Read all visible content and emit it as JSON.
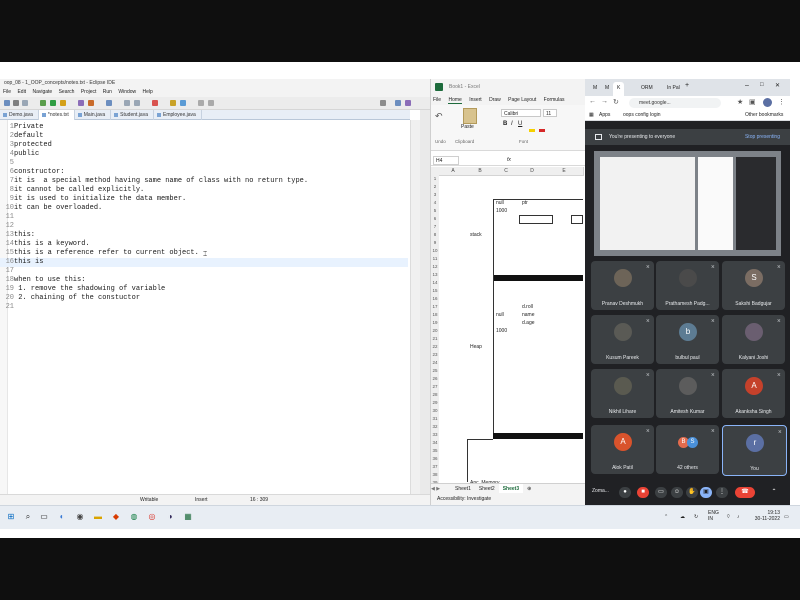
{
  "eclipse": {
    "title": "oop_08 - 1_OOP_concepts/notes.txt - Eclipse IDE",
    "menu": [
      "File",
      "Edit",
      "Navigate",
      "Search",
      "Project",
      "Run",
      "Window",
      "Help"
    ],
    "tabs": [
      {
        "label": "Demo.java",
        "active": false
      },
      {
        "label": "*notes.txt",
        "active": true
      },
      {
        "label": "Main.java",
        "active": false
      },
      {
        "label": "Student.java",
        "active": false
      },
      {
        "label": "Employee.java",
        "active": false
      }
    ],
    "code_lines": [
      {
        "n": "1",
        "text": "Private"
      },
      {
        "n": "2",
        "text": "default"
      },
      {
        "n": "3",
        "text": "protected"
      },
      {
        "n": "4",
        "text": "public"
      },
      {
        "n": "5",
        "text": ""
      },
      {
        "n": "6",
        "text": "constructor:"
      },
      {
        "n": "7",
        "text": "it is  a special method having same name of class with no return type."
      },
      {
        "n": "8",
        "text": "it cannot be called explicitly."
      },
      {
        "n": "9",
        "text": "it is used to initialize the data member."
      },
      {
        "n": "10",
        "text": "it can be overloaded."
      },
      {
        "n": "11",
        "text": ""
      },
      {
        "n": "12",
        "text": ""
      },
      {
        "n": "13",
        "text": "this:"
      },
      {
        "n": "14",
        "text": "this is a keyword."
      },
      {
        "n": "15",
        "text": "this is a reference refer to current object."
      },
      {
        "n": "16",
        "text": "this is "
      },
      {
        "n": "17",
        "text": ""
      },
      {
        "n": "18",
        "text": "when to use this:"
      },
      {
        "n": "19",
        "text": " 1. remove the shadowing of variable"
      },
      {
        "n": "20",
        "text": " 2. chaining of the constuctor"
      },
      {
        "n": "21",
        "text": ""
      }
    ],
    "status": {
      "mode": "Writable",
      "insert": "Insert",
      "position": "16 : 309"
    }
  },
  "excel": {
    "title": "Book1 - Excel",
    "ribbon_tabs": [
      "File",
      "Home",
      "Insert",
      "Draw",
      "Page Layout",
      "Formulas"
    ],
    "ribbon": {
      "paste": "Paste",
      "font": "Calibri",
      "size": "11",
      "undo": "Undo",
      "clipboard": "Clipboard",
      "font_group": "Font"
    },
    "name_box": "H4",
    "fx": "fx",
    "columns": [
      "A",
      "B",
      "C",
      "D",
      "E"
    ],
    "rows": [
      "1",
      "2",
      "3",
      "4",
      "5",
      "6",
      "7",
      "8",
      "9",
      "10",
      "11",
      "12",
      "13",
      "14",
      "15",
      "16",
      "17",
      "18",
      "19",
      "20",
      "21",
      "22",
      "23",
      "24",
      "25",
      "26",
      "27",
      "28",
      "29",
      "30",
      "31",
      "32",
      "33",
      "34",
      "35",
      "36",
      "37",
      "38",
      "39"
    ],
    "cells": [
      {
        "text": "stack",
        "col": "B",
        "row": 8
      },
      {
        "text": "null",
        "col": "C",
        "row": 4
      },
      {
        "text": "1000",
        "col": "C",
        "row": 5
      },
      {
        "text": "ptr",
        "col": "D",
        "row": 4
      },
      {
        "text": "Heap",
        "col": "B",
        "row": 22
      },
      {
        "text": "null",
        "col": "C",
        "row": 18
      },
      {
        "text": "1000",
        "col": "C",
        "row": 20
      },
      {
        "text": "d.roll",
        "col": "D",
        "row": 17
      },
      {
        "text": "name",
        "col": "D",
        "row": 18
      },
      {
        "text": "d.age",
        "col": "D",
        "row": 19
      },
      {
        "text": "Anc. Memory",
        "col": "B",
        "row": 39
      }
    ],
    "sheets": [
      {
        "label": "Sheet1",
        "active": false
      },
      {
        "label": "Sheet2",
        "active": false
      },
      {
        "label": "Sheet3",
        "active": true
      }
    ],
    "status": "Accessibility: Investigate"
  },
  "chrome": {
    "tabs": [
      {
        "label": "M",
        "active": false
      },
      {
        "label": "M",
        "active": false
      },
      {
        "label": "K",
        "active": true
      },
      {
        "label": "ORM",
        "active": false
      },
      {
        "label": "In Pal",
        "active": false
      }
    ],
    "url": "meet.google...",
    "bookmarks": [
      "Apps",
      "oops config login",
      "Other bookmarks"
    ]
  },
  "meet": {
    "presenting_text": "You're presenting to everyone",
    "stop_label": "Stop presenting",
    "participants": [
      {
        "name": "Pranav Deshmukh",
        "initial": "",
        "color": "#6d6458"
      },
      {
        "name": "Prathamesh Padg...",
        "initial": "",
        "color": "#4a4a4a"
      },
      {
        "name": "Sakshi Badgujar",
        "initial": "S",
        "color": "#7b6d63"
      },
      {
        "name": "Kusum Pareek",
        "initial": "",
        "color": "#5a5a55"
      },
      {
        "name": "bulbul paul",
        "initial": "b",
        "color": "#5d7c93"
      },
      {
        "name": "Kalyani Joshi",
        "initial": "",
        "color": "#6a5e70"
      },
      {
        "name": "Nikhil Lihare",
        "initial": "",
        "color": "#5a5a50"
      },
      {
        "name": "Amitesh Kumar",
        "initial": "",
        "color": "#5c5c5c"
      },
      {
        "name": "Akanksha Singh",
        "initial": "A",
        "color": "#c5412b"
      },
      {
        "name": "Alok Patil",
        "initial": "A",
        "color": "#d9532c"
      },
      {
        "name": "42 others",
        "initial": "",
        "color": ""
      },
      {
        "name": "You",
        "initial": "r",
        "color": "#5b6fa3"
      }
    ],
    "others_avatars": [
      "B",
      "S"
    ],
    "meeting_code": "Zoma..."
  },
  "taskbar": {
    "lang": "ENG",
    "region": "IN",
    "time": "19:13",
    "date": "30-11-2022"
  }
}
